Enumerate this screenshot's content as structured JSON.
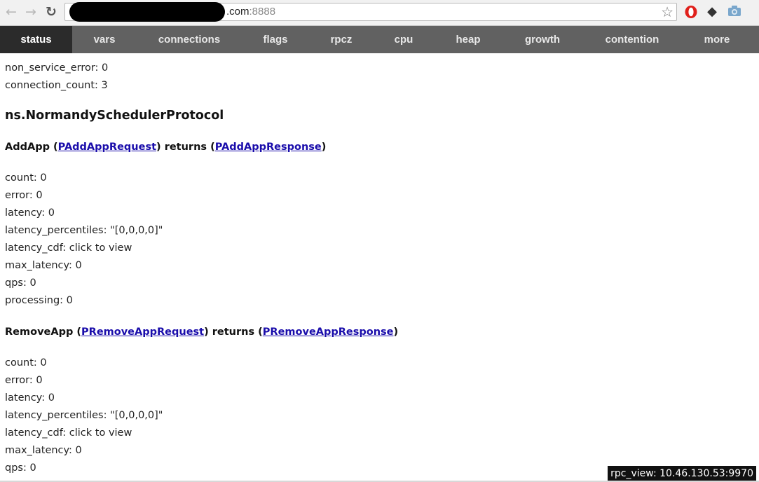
{
  "browser": {
    "url_visible": ".com",
    "url_port": ":8888",
    "icons": [
      "back-arrow-icon",
      "forward-arrow-icon",
      "reload-icon",
      "bookmark-star-icon",
      "opera-icon",
      "extension-icon",
      "camera-icon"
    ]
  },
  "tabs": [
    {
      "label": "status",
      "active": true
    },
    {
      "label": "vars",
      "active": false
    },
    {
      "label": "connections",
      "active": false
    },
    {
      "label": "flags",
      "active": false
    },
    {
      "label": "rpcz",
      "active": false
    },
    {
      "label": "cpu",
      "active": false
    },
    {
      "label": "heap",
      "active": false
    },
    {
      "label": "growth",
      "active": false
    },
    {
      "label": "contention",
      "active": false
    },
    {
      "label": "more",
      "active": false
    }
  ],
  "top_stats": [
    "non_service_error: 0",
    "connection_count: 3"
  ],
  "protocol_title": "ns.NormandySchedulerProtocol",
  "methods": [
    {
      "name": "AddApp",
      "open1": " (",
      "request": "PAddAppRequest",
      "mid": ") returns (",
      "response": "PAddAppResponse",
      "close": ")",
      "stats": [
        "count: 0",
        "error: 0",
        "latency: 0",
        "latency_percentiles: \"[0,0,0,0]\"",
        "latency_cdf: click to view",
        "max_latency: 0",
        "qps: 0",
        "processing: 0"
      ]
    },
    {
      "name": "RemoveApp",
      "open1": " (",
      "request": "PRemoveAppRequest",
      "mid": ") returns (",
      "response": "PRemoveAppResponse",
      "close": ")",
      "stats": [
        "count: 0",
        "error: 0",
        "latency: 0",
        "latency_percentiles: \"[0,0,0,0]\"",
        "latency_cdf: click to view",
        "max_latency: 0",
        "qps: 0"
      ]
    }
  ],
  "status_bar": "rpc_view: 10.46.130.53:9970",
  "colors": {
    "tabbar_bg": "#616161",
    "active_tab_bg": "#2b2b2b",
    "link": "#1a0dab"
  }
}
